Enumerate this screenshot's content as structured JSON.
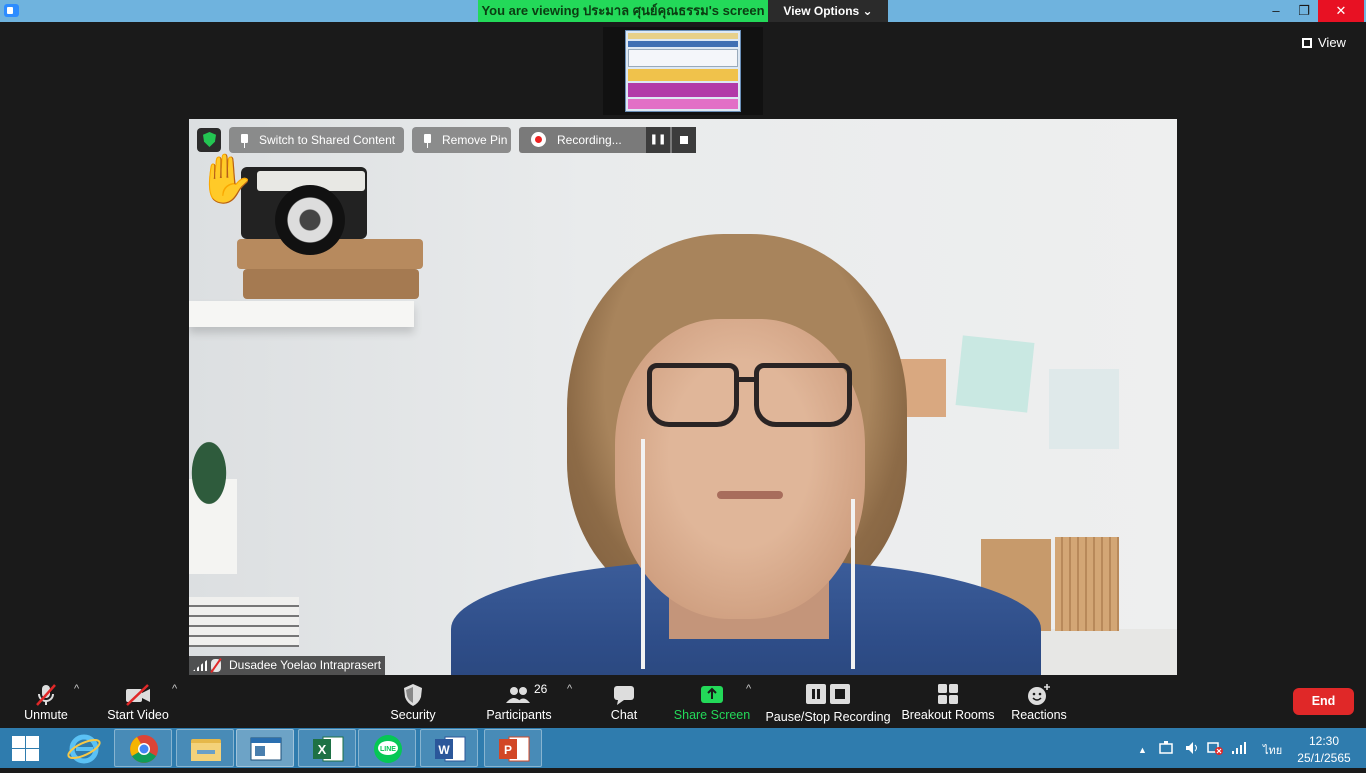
{
  "titlebar": {
    "share_banner": "You are viewing ประมาล ศุนย์คุณธรรม's screen",
    "view_options": "View Options ⌄",
    "minimize": "–",
    "restore": "❐",
    "close": "✕"
  },
  "meeting": {
    "view_label": "View",
    "video_controls": {
      "switch_shared": "Switch to Shared Content",
      "remove_pin": "Remove Pin",
      "recording": "Recording...",
      "pause_glyph": "❚❚"
    },
    "participant_name": "Dusadee Yoelao Intraprasert",
    "raised_hand": "✋"
  },
  "toolbar": {
    "unmute": "Unmute",
    "start_video": "Start Video",
    "security": "Security",
    "participants": "Participants",
    "participants_count": "26",
    "chat": "Chat",
    "share_screen": "Share Screen",
    "recording": "Pause/Stop Recording",
    "breakout": "Breakout Rooms",
    "reactions": "Reactions",
    "end": "End",
    "caret": "^"
  },
  "taskbar": {
    "apps": [
      "internet-explorer",
      "chrome",
      "file-explorer",
      "active-window",
      "excel",
      "line",
      "word",
      "powerpoint"
    ],
    "tray_language": "ไทย",
    "tray_arrow": "▲",
    "clock_time": "12:30",
    "clock_date": "25/1/2565"
  },
  "colors": {
    "zoom_green": "#23d959",
    "end_red": "#e02828",
    "taskbar_blue": "#2f7cae"
  }
}
